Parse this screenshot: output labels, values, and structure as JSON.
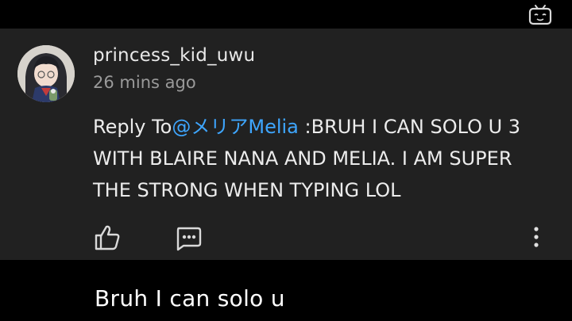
{
  "comment": {
    "username": "princess_kid_uwu",
    "timestamp": "26 mins ago",
    "reply_prefix": "Reply To",
    "mention": "@メリアMelia",
    "text": " :BRUH I CAN SOLO U 3 WITH BLAIRE NANA AND MELIA. I AM SUPER THE STRONG WHEN TYPING LOL",
    "avatar_icon": "anime-girl-avatar",
    "actions": {
      "like_icon": "thumbs-up-icon",
      "reply_icon": "chat-bubble-icon",
      "more_icon": "vertical-ellipsis-icon"
    }
  },
  "subtitle": "Bruh I can solo u",
  "watermark_icon": "tv-logo-icon",
  "colors": {
    "card_bg": "#212121",
    "page_bg": "#000000",
    "mention": "#3ea6ff",
    "timestamp": "#9a9a9a"
  }
}
